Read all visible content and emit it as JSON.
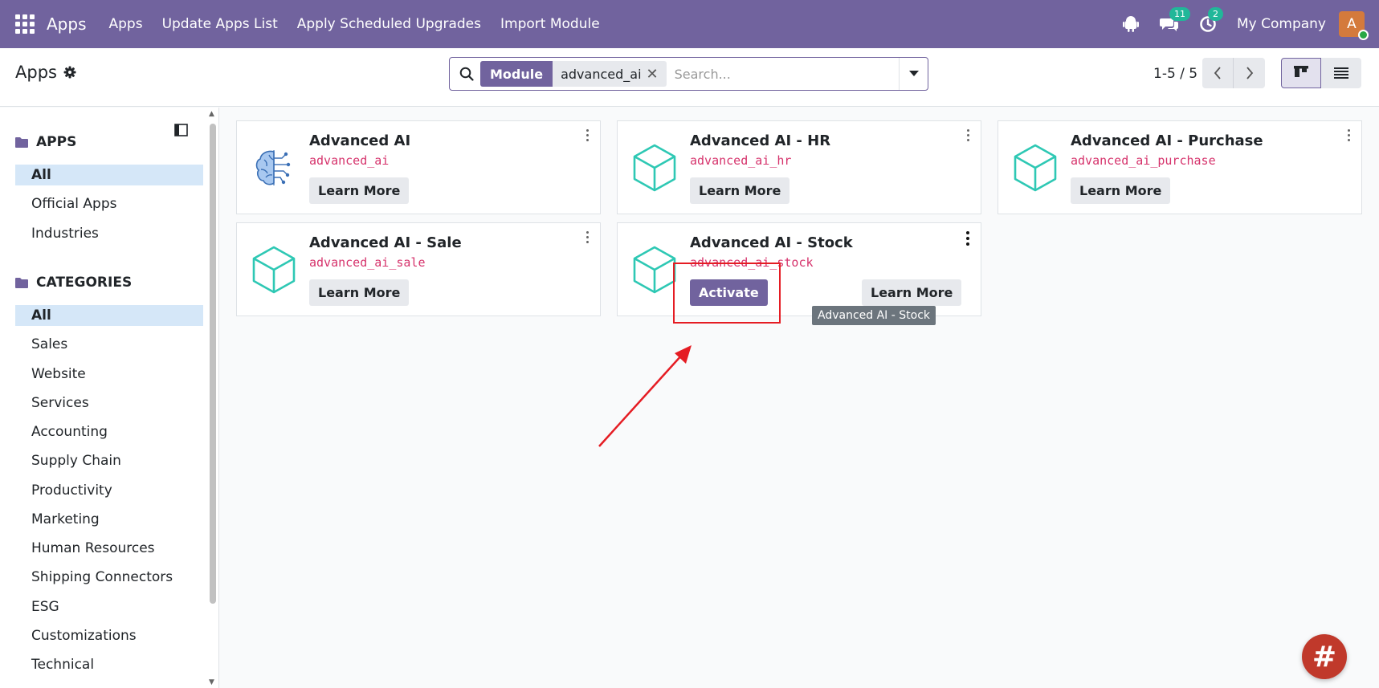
{
  "navbar": {
    "brand": "Apps",
    "menu": [
      "Apps",
      "Update Apps List",
      "Apply Scheduled Upgrades",
      "Import Module"
    ],
    "messages_badge": "11",
    "activities_badge": "2",
    "company": "My Company",
    "avatar_letter": "A"
  },
  "control": {
    "breadcrumb": "Apps",
    "facet_label": "Module",
    "facet_value": "advanced_ai",
    "facet_remove": "✕",
    "search_placeholder": "Search...",
    "pager": "1-5 / 5"
  },
  "sidebar": {
    "apps_header": "APPS",
    "apps_items": [
      "All",
      "Official Apps",
      "Industries"
    ],
    "categories_header": "CATEGORIES",
    "category_items": [
      "All",
      "Sales",
      "Website",
      "Services",
      "Accounting",
      "Supply Chain",
      "Productivity",
      "Marketing",
      "Human Resources",
      "Shipping Connectors",
      "ESG",
      "Customizations",
      "Technical"
    ]
  },
  "modules": [
    {
      "title": "Advanced AI",
      "code": "advanced_ai",
      "icon": "brain-icon",
      "learn": "Learn More"
    },
    {
      "title": "Advanced AI - HR",
      "code": "advanced_ai_hr",
      "icon": "cube-icon",
      "learn": "Learn More"
    },
    {
      "title": "Advanced AI - Purchase",
      "code": "advanced_ai_purchase",
      "icon": "cube-icon",
      "learn": "Learn More"
    },
    {
      "title": "Advanced AI - Sale",
      "code": "advanced_ai_sale",
      "icon": "cube-icon",
      "learn": "Learn More"
    },
    {
      "title": "Advanced AI - Stock",
      "code": "advanced_ai_stock",
      "icon": "cube-icon",
      "learn": "Learn More",
      "activate": "Activate"
    }
  ],
  "tooltip": "Advanced AI - Stock",
  "fab_label": "#",
  "colors": {
    "brand": "#71639e",
    "badge": "#21b799",
    "module_code": "#d6336c",
    "highlight": "#e51c23",
    "cube": "#2ec8b4"
  }
}
